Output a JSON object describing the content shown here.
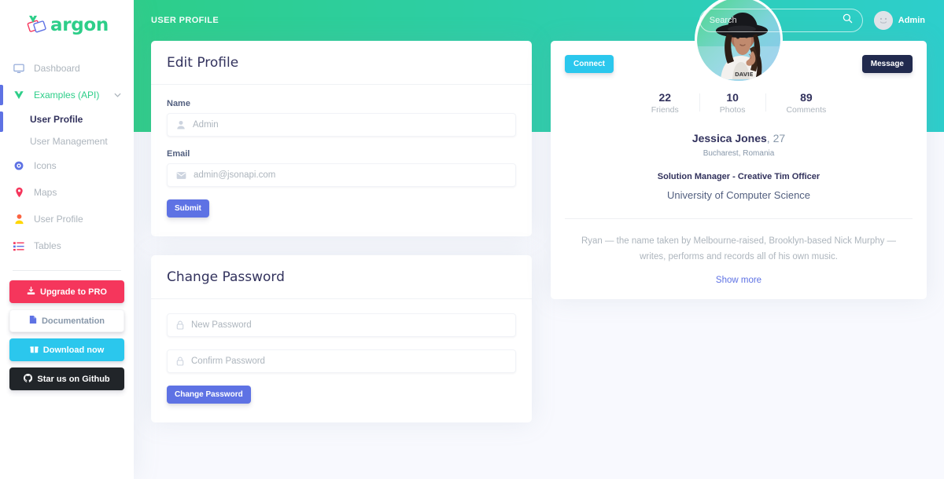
{
  "brand": {
    "name": "argon",
    "logo_icon": "vue-argon-logo-icon"
  },
  "sidebar": {
    "items": [
      {
        "label": "Dashboard",
        "icon": "tv-monitor-icon",
        "state": "default"
      },
      {
        "label": "Examples (API)",
        "icon": "vue-shield-icon",
        "state": "expanded",
        "chevron": "ⱟ"
      },
      {
        "label": "Icons",
        "icon": "bullseye-icon",
        "state": "default"
      },
      {
        "label": "Maps",
        "icon": "map-pin-icon",
        "state": "default"
      },
      {
        "label": "User Profile",
        "icon": "person-icon",
        "state": "default"
      },
      {
        "label": "Tables",
        "icon": "list-bullet-icon",
        "state": "default"
      }
    ],
    "subitems": [
      {
        "label": "User Profile",
        "active": true
      },
      {
        "label": "User Management",
        "active": false
      }
    ],
    "buttons": [
      {
        "label": "Upgrade to PRO",
        "icon": "download-box-icon",
        "color": "#f5365c"
      },
      {
        "label": "Documentation",
        "icon": "document-icon",
        "color": "#ffffff"
      },
      {
        "label": "Download now",
        "icon": "gift-icon",
        "color": "#2bc7ed"
      },
      {
        "label": "Star us on Github",
        "icon": "github-icon",
        "color": "#212529"
      }
    ]
  },
  "topnav": {
    "page_title": "USER PROFILE",
    "search": {
      "placeholder": "Search",
      "value": "",
      "icon": "search-icon"
    },
    "user": {
      "name": "Admin",
      "avatar_icon": "user-avatar-icon"
    }
  },
  "edit_profile": {
    "title": "Edit Profile",
    "fields": [
      {
        "label": "Name",
        "placeholder": "Admin",
        "value": "",
        "icon": "person-icon"
      },
      {
        "label": "Email",
        "placeholder": "admin@jsonapi.com",
        "value": "",
        "icon": "envelope-icon"
      }
    ],
    "submit_label": "Submit"
  },
  "change_password": {
    "title": "Change Password",
    "fields": [
      {
        "placeholder": "New Password",
        "value": "",
        "icon": "lock-icon"
      },
      {
        "placeholder": "Confirm Password",
        "value": "",
        "icon": "lock-icon"
      }
    ],
    "submit_label": "Change Password"
  },
  "profile": {
    "connect_label": "Connect",
    "message_label": "Message",
    "avatar_icon": "profile-photo-woman-hat",
    "stats": [
      {
        "value": "22",
        "label": "Friends"
      },
      {
        "value": "10",
        "label": "Photos"
      },
      {
        "value": "89",
        "label": "Comments"
      }
    ],
    "name": "Jessica Jones",
    "age": ", 27",
    "location": "Bucharest, Romania",
    "job": "Solution Manager - Creative Tim Officer",
    "education": "University of Computer Science",
    "bio": "Ryan — the name taken by Melbourne-raised, Brooklyn-based Nick Murphy — writes, performs and records all of his own music.",
    "show_more_label": "Show more"
  },
  "colors": {
    "header_gradient_from": "#2dce89",
    "header_gradient_to": "#2dcecc",
    "primary": "#5e72e4",
    "danger": "#f5365c",
    "info": "#2bc7ed",
    "dark": "#212529",
    "page_bg": "#f8f9fe"
  }
}
